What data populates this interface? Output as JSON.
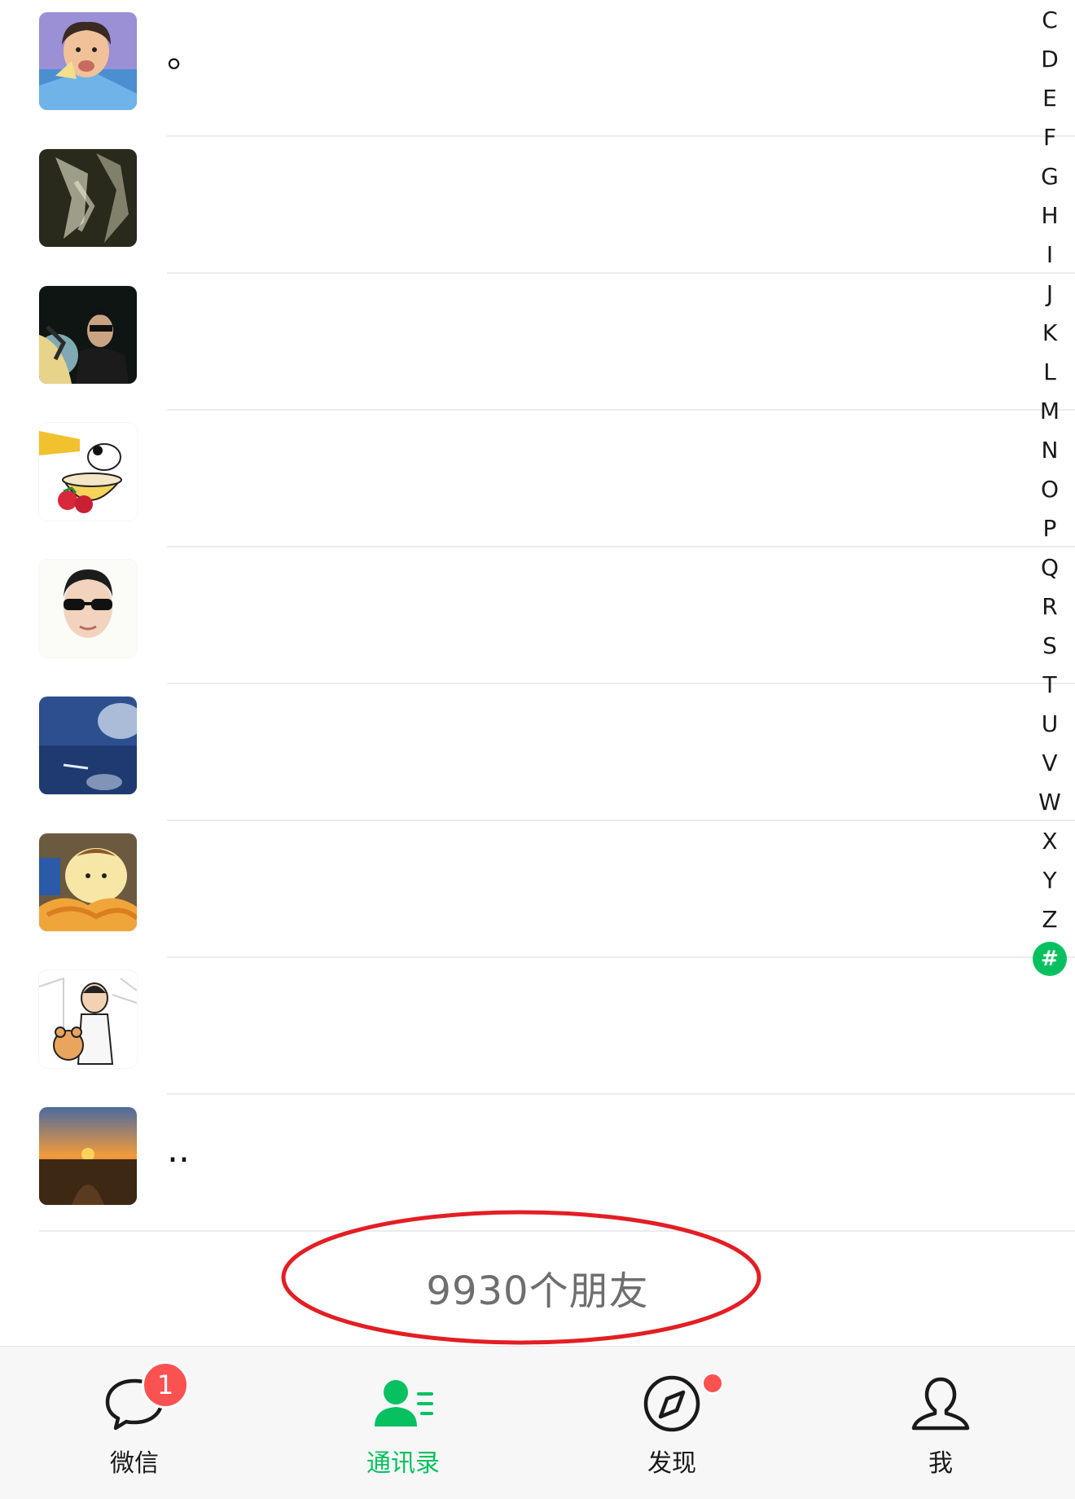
{
  "contacts": [
    {
      "name": "。",
      "avatar": "cartoon-man-avatar"
    },
    {
      "name": "",
      "avatar": "dark-texture-avatar"
    },
    {
      "name": "",
      "avatar": "man-with-tiger-avatar"
    },
    {
      "name": "",
      "avatar": "dog-in-teacup-avatar"
    },
    {
      "name": "",
      "avatar": "boy-sunglasses-avatar"
    },
    {
      "name": "",
      "avatar": "blue-sky-avatar"
    },
    {
      "name": "",
      "avatar": "pompompurin-avatar"
    },
    {
      "name": "",
      "avatar": "cartoon-kid-bear-avatar"
    },
    {
      "name": "..",
      "avatar": "sunset-field-avatar"
    }
  ],
  "alpha_index": [
    "C",
    "D",
    "E",
    "F",
    "G",
    "H",
    "I",
    "J",
    "K",
    "L",
    "M",
    "N",
    "O",
    "P",
    "Q",
    "R",
    "S",
    "T",
    "U",
    "V",
    "W",
    "X",
    "Y",
    "Z",
    "#"
  ],
  "alpha_active": "#",
  "friend_count_text": "9930个朋友",
  "tabs": [
    {
      "label": "微信",
      "icon": "chat-bubble-icon",
      "badge": "1"
    },
    {
      "label": "通讯录",
      "icon": "contacts-icon",
      "active": true
    },
    {
      "label": "发现",
      "icon": "compass-icon",
      "dot": true
    },
    {
      "label": "我",
      "icon": "person-icon"
    }
  ],
  "colors": {
    "accent": "#07c160",
    "badge": "#fa5151",
    "highlight": "#e31e24"
  }
}
